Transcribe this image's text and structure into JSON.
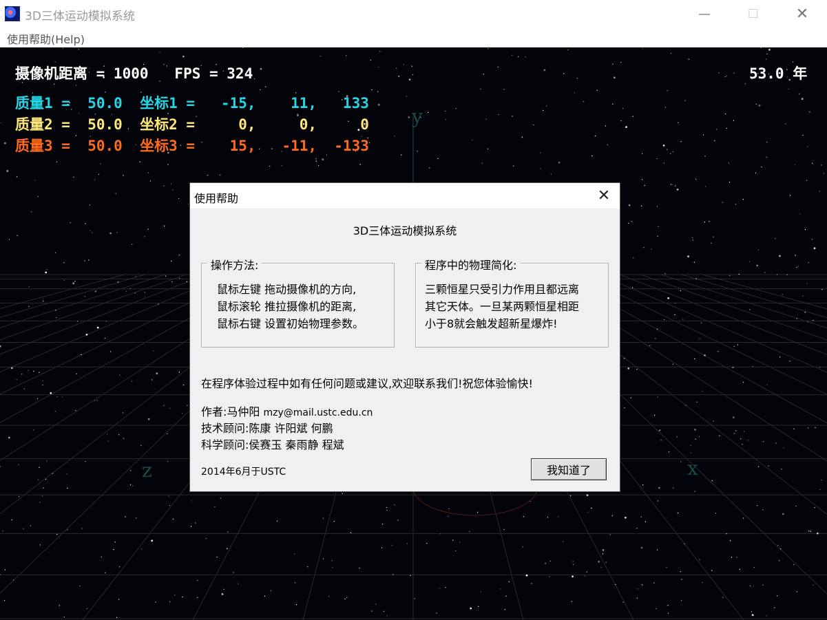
{
  "window": {
    "title": "3D三体运动模拟系统",
    "minimize": "—",
    "maximize": "☐",
    "close": "✕"
  },
  "menu": {
    "help": "使用帮助(Help)"
  },
  "hud": {
    "camera_line": "摄像机距离 = 1000   FPS = 324",
    "time_line": "53.0 年",
    "body1": "质量1 =  50.0  坐标1 =   -15,    11,   133",
    "body2": "质量2 =  50.0  坐标2 =     0,     0,     0",
    "body3": "质量3 =  50.0  坐标3 =    15,   -11,  -133",
    "colors": {
      "body1": "#25d6e6",
      "body2": "#ffe879",
      "body3": "#ff6b1a"
    }
  },
  "axes": {
    "y": "y",
    "z": "z",
    "x": "x"
  },
  "dialog": {
    "title": "使用帮助",
    "heading": "3D三体运动模拟系统",
    "ops": {
      "legend": "操作方法:",
      "lines": [
        "鼠标左键 拖动摄像机的方向,",
        "鼠标滚轮 推拉摄像机的距离,",
        "鼠标右键 设置初始物理参数。"
      ]
    },
    "physics": {
      "legend": "程序中的物理简化:",
      "lines": [
        "三颗恒星只受引力作用且都远离",
        "其它天体。一旦某两颗恒星相距",
        "小于8就会触发超新星爆炸!"
      ]
    },
    "contact": "在程序体验过程中如有任何问题或建议,欢迎联系我们!祝您体验愉快!",
    "author_label": "作者:马仲阳",
    "author_email": "mzy@mail.ustc.edu.cn",
    "tech_advisors": "技术顾问:陈康 许阳斌 何鹏",
    "sci_advisors": "科学顾问:侯赛玉 秦雨静 程斌",
    "date": "2014年6月于USTC",
    "ok_button": "我知道了"
  }
}
